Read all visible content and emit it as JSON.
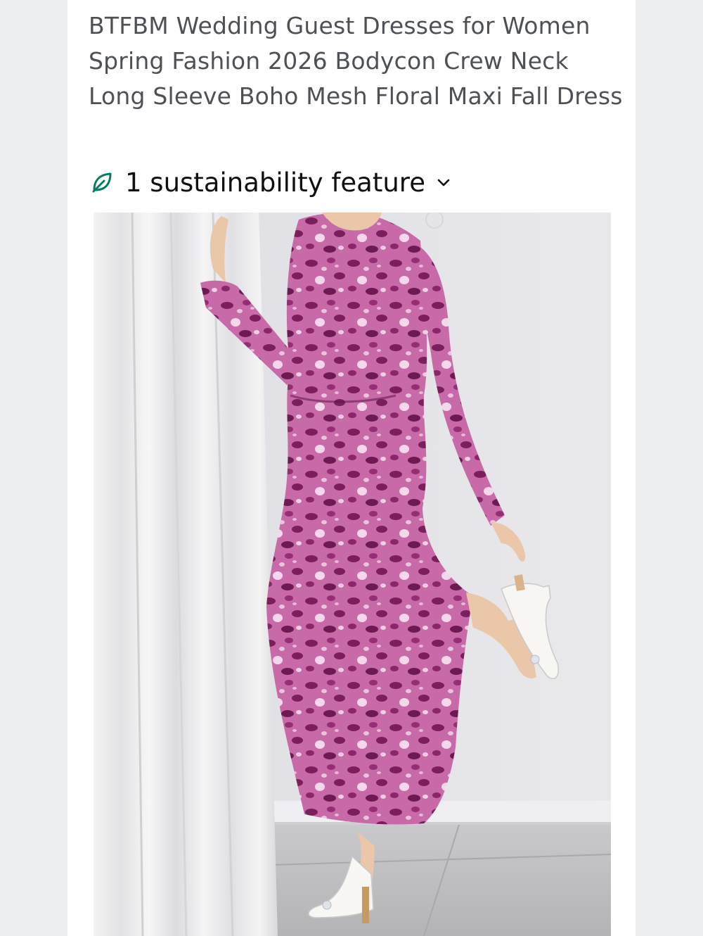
{
  "product": {
    "title": "BTFBM Wedding Guest Dresses for Women Spring Fashion 2026 Bodycon Crew Neck Long Sleeve Boho Mesh Floral Maxi Fall Dress",
    "sustainability_label": "1 sustainability feature",
    "image_alt": "Model wearing a purple leopard print long sleeve mesh maxi dress with white pointed heels"
  },
  "colors": {
    "page_background": "#eceef0",
    "card_background": "#ffffff",
    "title_text": "#4d5155",
    "sustainability_accent": "#067d62",
    "dress_primary": "#b24a8e",
    "dress_dark": "#7a1f5c"
  },
  "icons": {
    "sustainability": "leaf-icon",
    "expand": "chevron-down-icon"
  }
}
